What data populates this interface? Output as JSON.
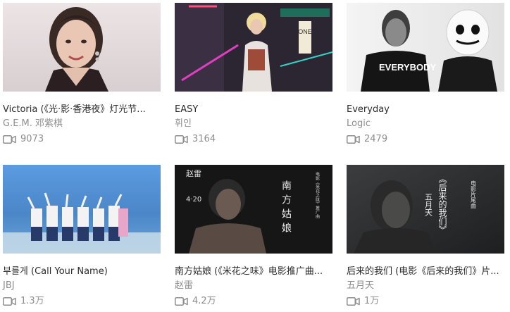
{
  "videos": [
    {
      "title": "Victoria (《光·影·香港夜》灯光节...",
      "artist": "G.E.M. 邓紫棋",
      "views": "9073",
      "thumb_bg": "#e9dfe0",
      "thumb_desc": "woman-portrait"
    },
    {
      "title": "EASY",
      "artist": "휘인",
      "views": "3164",
      "thumb_bg": "#2c2633",
      "thumb_desc": "neon-room"
    },
    {
      "title": "Everyday",
      "artist": "Logic",
      "views": "2479",
      "thumb_bg": "#efefef",
      "thumb_desc": "two-artists-bw"
    },
    {
      "title": "부를게 (Call Your Name)",
      "artist": "JBJ",
      "views": "1.3万",
      "thumb_bg": "#4f8fd1",
      "thumb_desc": "group-at-sea"
    },
    {
      "title": "南方姑娘 (《米花之味》电影推广曲...",
      "artist": "赵雷",
      "views": "4.2万",
      "thumb_bg": "#1c1c1c",
      "thumb_desc": "poster-dark"
    },
    {
      "title": "后来的我们 (电影《后来的我们》片...",
      "artist": "五月天",
      "views": "1万",
      "thumb_bg": "#2a2c2e",
      "thumb_desc": "poster-film"
    }
  ],
  "overlay_text": {
    "easy_sign": "ONE",
    "everybody": "EVERYBODY",
    "south_title": "南方姑娘",
    "south_artist": "赵雷",
    "south_date": "4·20",
    "south_side": "电影《米花之味》推广曲",
    "later_title": "《后来的我们》",
    "later_sub": "电影片尾曲",
    "later_band": "五月天"
  },
  "icons": {
    "views": "video-camera-icon"
  }
}
